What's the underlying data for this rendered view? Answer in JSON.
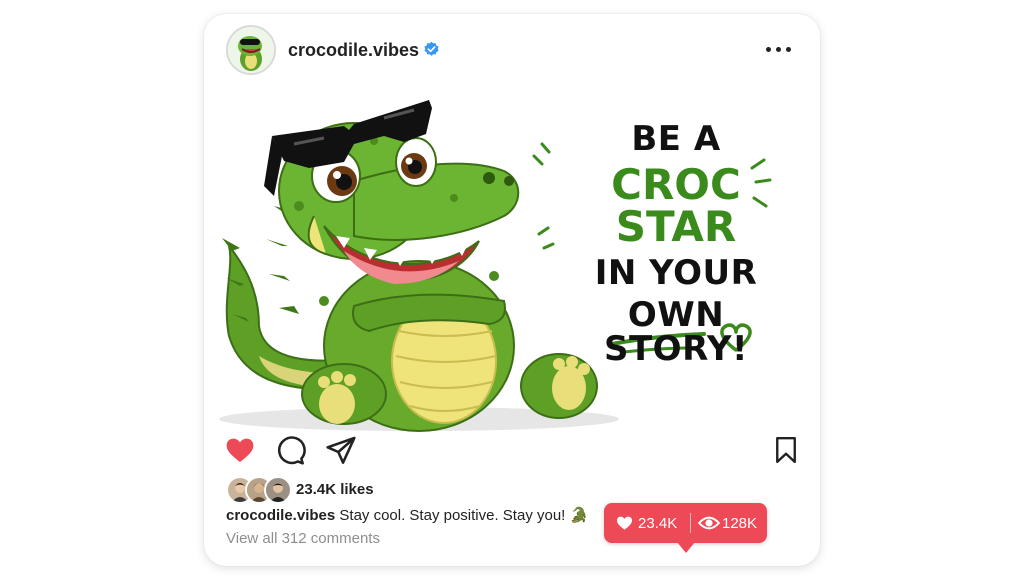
{
  "post": {
    "username": "crocodile.vibes",
    "verified": true,
    "image": {
      "line1": "BE A",
      "line2": "CROC STAR",
      "line3": "IN YOUR",
      "line4": "OWN STORY!"
    },
    "likes_text": "23.4K likes",
    "caption_username": "crocodile.vibes",
    "caption_text": "Stay cool. Stay positive. Stay you! 🐊",
    "comments_link": "View all 312 comments"
  },
  "notification": {
    "likes_count": "23.4K",
    "views_count": "128K"
  },
  "icons": {
    "more": "more-options-icon",
    "like": "heart-icon",
    "comment": "comment-icon",
    "share": "send-icon",
    "save": "bookmark-icon",
    "verified": "verified-badge-icon",
    "views": "eye-icon"
  },
  "colors": {
    "heart": "#ed4956",
    "verified": "#3897f0",
    "accent_green": "#3a8a1c",
    "notification_bg": "#ed4956"
  }
}
